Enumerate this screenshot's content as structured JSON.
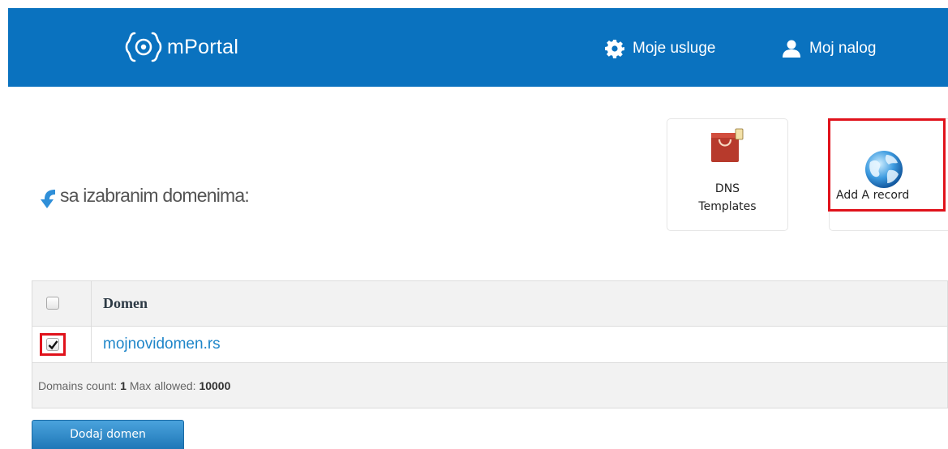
{
  "header": {
    "brand_name": "mPortal",
    "nav": {
      "services_label": "Moje usluge",
      "account_label": "Moj nalog"
    }
  },
  "bulk_actions": {
    "label": "sa izabranim domenima:",
    "tiles": [
      {
        "label_line1": "DNS",
        "label_line2": "Templates",
        "icon": "shopping-bag-icon"
      },
      {
        "label": "Add A record",
        "icon": "globe-icon"
      }
    ]
  },
  "table": {
    "header_domain": "Domen",
    "rows": [
      {
        "domain": "mojnovidomen.rs",
        "checked": true
      }
    ],
    "footer": {
      "count_label": "Domains count:",
      "count_value": "1",
      "max_label": "Max allowed:",
      "max_value": "10000"
    }
  },
  "add_domain_button": "Dodaj domen",
  "colors": {
    "header_bg": "#0a72bf",
    "link": "#1f86c9",
    "highlight": "#e0121b"
  }
}
